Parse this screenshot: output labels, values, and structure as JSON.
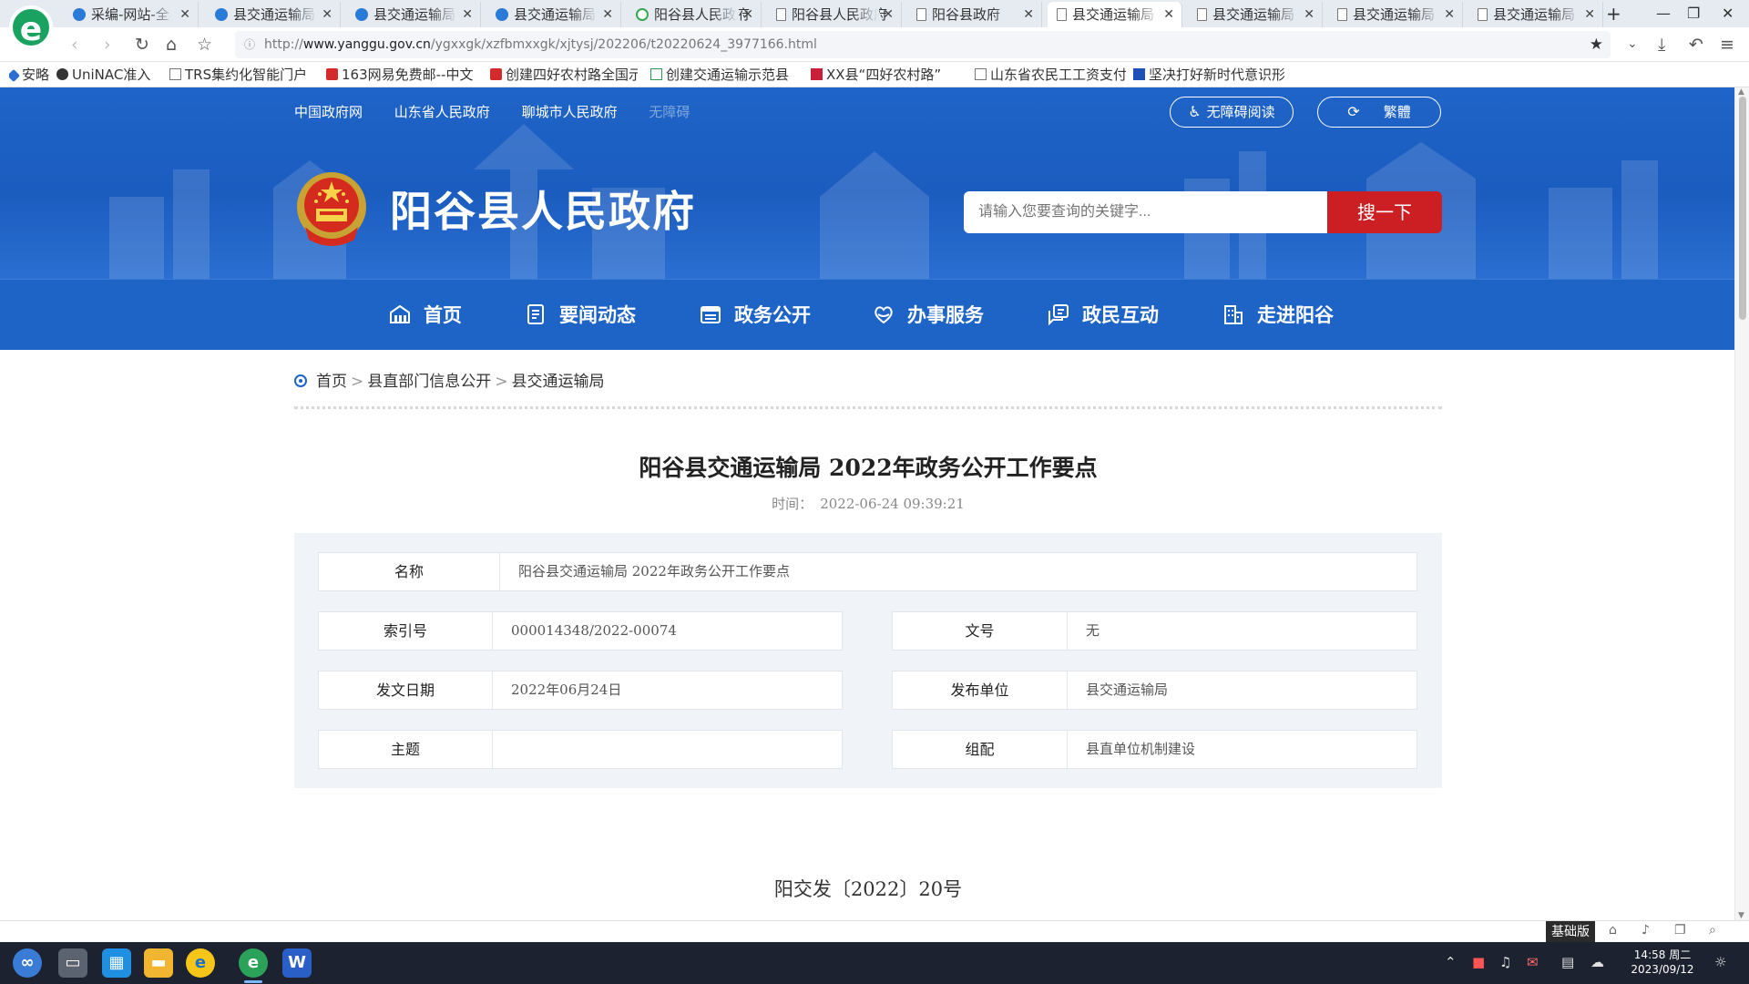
{
  "browser": {
    "logo_letter": "e",
    "tabs": [
      {
        "label": "采编-网站-全",
        "icon": "ie"
      },
      {
        "label": "县交通运输局",
        "icon": "ie"
      },
      {
        "label": "县交通运输局",
        "icon": "ie"
      },
      {
        "label": "县交通运输局",
        "icon": "ie"
      },
      {
        "label": "阳谷县人民政府",
        "icon": "green"
      },
      {
        "label": "阳谷县人民政府",
        "icon": "doc"
      },
      {
        "label": "阳谷县政府",
        "icon": "doc"
      },
      {
        "label": "县交通运输局",
        "icon": "doc",
        "active": true
      },
      {
        "label": "县交通运输局",
        "icon": "doc"
      },
      {
        "label": "县交通运输局",
        "icon": "doc"
      },
      {
        "label": "县交通运输局",
        "icon": "doc"
      }
    ],
    "url_prefix": "http://",
    "url_host": "www.yanggu.gov.cn",
    "url_path": "/ygxxgk/xzfbmxxgk/xjtysj/202206/t20220624_3977166.html",
    "bookmarks": [
      {
        "label": "安略",
        "icon": "blue"
      },
      {
        "label": "UniNAC准入",
        "icon": "dot"
      },
      {
        "label": "TRS集约化智能门户",
        "icon": "doc"
      },
      {
        "label": "163网易免费邮--中文",
        "icon": "red"
      },
      {
        "label": "创建四好农村路全国示",
        "icon": "red"
      },
      {
        "label": "创建交通运输示范县",
        "icon": "greensq"
      },
      {
        "label": "XX县“四好农村路”",
        "icon": "xx"
      },
      {
        "label": "山东省农民工工资支付",
        "icon": "doc"
      },
      {
        "label": "坚决打好新时代意识形",
        "icon": "pc"
      }
    ]
  },
  "header": {
    "top_links": [
      "中国政府网",
      "山东省人民政府",
      "聊城市人民政府",
      "无障碍"
    ],
    "accessibility_label": "无障碍阅读",
    "traditional_label": "繁體",
    "site_title": "阳谷县人民政府",
    "search_placeholder": "请输入您要查询的关键字...",
    "search_button": "搜一下"
  },
  "nav": [
    {
      "label": "首页",
      "icon": "home-icon"
    },
    {
      "label": "要闻动态",
      "icon": "news-icon"
    },
    {
      "label": "政务公开",
      "icon": "gov-open-icon"
    },
    {
      "label": "办事服务",
      "icon": "service-icon"
    },
    {
      "label": "政民互动",
      "icon": "interaction-icon"
    },
    {
      "label": "走进阳谷",
      "icon": "building-icon"
    }
  ],
  "breadcrumb": [
    "首页",
    "县直部门信息公开",
    "县交通运输局"
  ],
  "breadcrumb_sep": ">",
  "article": {
    "title": "阳谷县交通运输局 2022年政务公开工作要点",
    "time_label": "时间：",
    "time_value": "2022-06-24 09:39:21",
    "meta": {
      "name_label": "名称",
      "name_value": "阳谷县交通运输局 2022年政务公开工作要点",
      "index_label": "索引号",
      "index_value": "000014348/2022-00074",
      "docno_label": "文号",
      "docno_value": "无",
      "date_label": "发文日期",
      "date_value": "2022年06月24日",
      "publisher_label": "发布单位",
      "publisher_value": "县交通运输局",
      "topic_label": "主题",
      "topic_value": "",
      "category_label": "组配",
      "category_value": "县直单位机制建设"
    },
    "doc_number": "阳交发〔2022〕20号"
  },
  "statusbar": {
    "basic_label": "基础版"
  },
  "taskbar": {
    "time": "14:58 周二",
    "date": "2023/09/12",
    "w_letter": "W",
    "browser_letter": "e"
  },
  "colors": {
    "primary_blue": "#1e64c6",
    "search_red": "#cc1f24",
    "panel_bg": "#f0f3f8"
  }
}
